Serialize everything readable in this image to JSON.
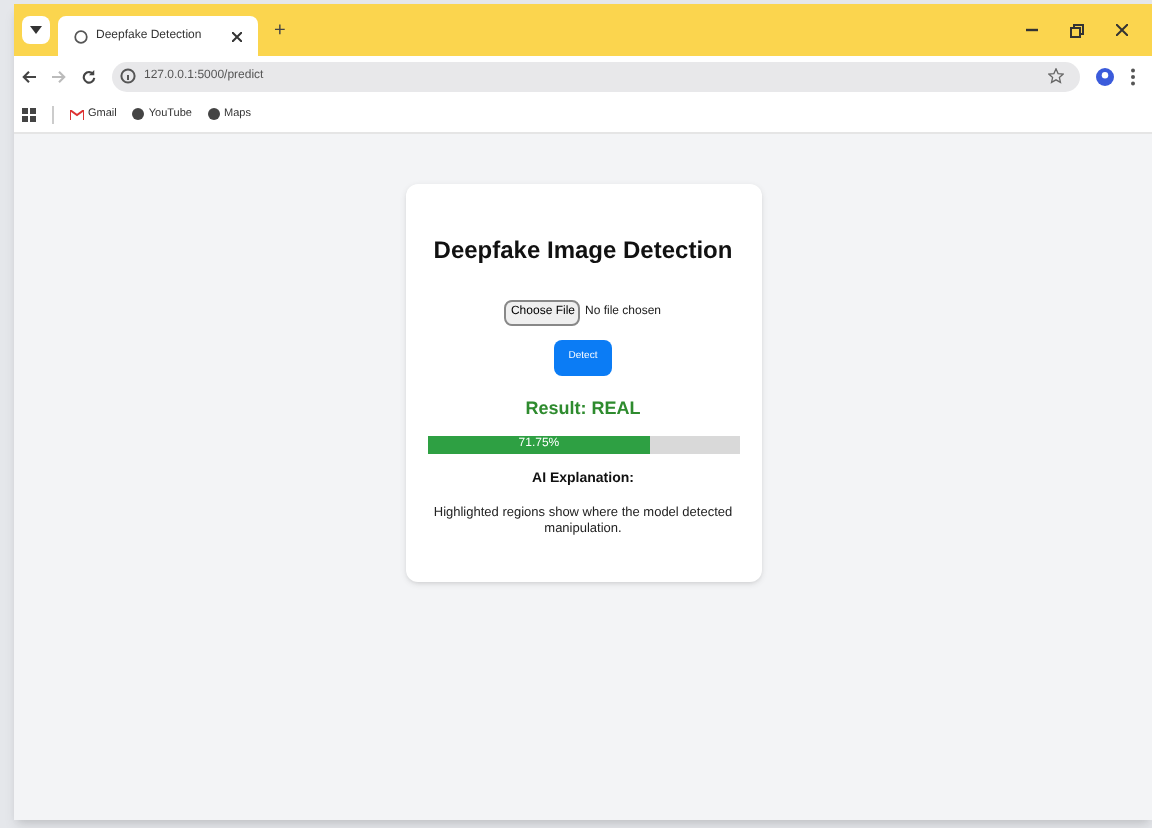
{
  "browser": {
    "tab_title": "Deepfake Detection",
    "new_tab": "+",
    "url": "127.0.0.1:5000/predict",
    "bookmarks": [
      "Gmail",
      "YouTube",
      "Maps"
    ]
  },
  "card": {
    "title": "Deepfake Image Detection",
    "file_button": "Choose File",
    "file_status": "No file chosen",
    "detect_button": "Detect",
    "result": "Result: REAL",
    "confidence": {
      "level": 0.7175,
      "reading": "71.75%"
    },
    "explanation_title": "AI Explanation:",
    "explanation": "Highlighted regions show where the model detected manipulation."
  }
}
